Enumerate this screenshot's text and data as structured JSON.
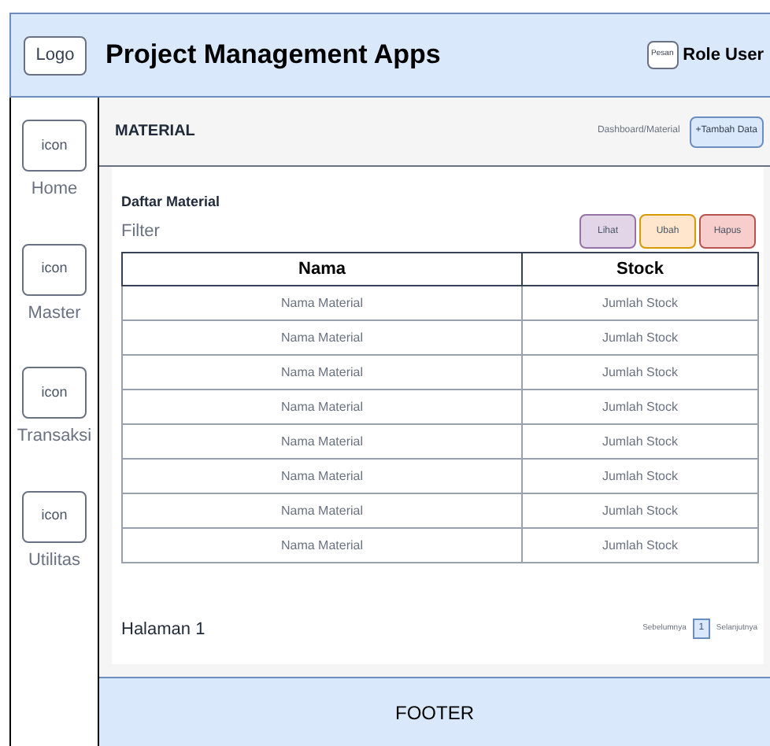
{
  "header": {
    "logo": "Logo",
    "title": "Project Management Apps",
    "message_button": "Pesan",
    "user": "Role User"
  },
  "sidebar": {
    "items": [
      {
        "icon": "icon",
        "label": "Home"
      },
      {
        "icon": "icon",
        "label": "Master"
      },
      {
        "icon": "icon",
        "label": "Transaksi"
      },
      {
        "icon": "icon",
        "label": "Utilitas"
      }
    ]
  },
  "page_header": {
    "title": "MATERIAL",
    "breadcrumb": "Dashboard/Material",
    "add_button": "+Tambah Data"
  },
  "card": {
    "title": "Daftar Material",
    "filter": "Filter",
    "actions": [
      {
        "label": "Lihat",
        "color": "#e1d5e7"
      },
      {
        "label": "Ubah",
        "color": "#ffe6cc"
      },
      {
        "label": "Hapus",
        "color": "#f8cecc"
      }
    ]
  },
  "table": {
    "columns": [
      "Nama",
      "Stock"
    ],
    "rows": [
      [
        "Nama Material",
        "Jumlah Stock"
      ],
      [
        "Nama Material",
        "Jumlah Stock"
      ],
      [
        "Nama Material",
        "Jumlah Stock"
      ],
      [
        "Nama Material",
        "Jumlah Stock"
      ],
      [
        "Nama Material",
        "Jumlah Stock"
      ],
      [
        "Nama Material",
        "Jumlah Stock"
      ],
      [
        "Nama Material",
        "Jumlah Stock"
      ],
      [
        "Nama Material",
        "Jumlah Stock"
      ]
    ]
  },
  "pagination": {
    "label": "Halaman 1",
    "previous": "Sebelumnya",
    "pages": [
      {
        "label": "1",
        "selected": true
      }
    ],
    "next": "Selanjutnya"
  },
  "footer": "FOOTER"
}
